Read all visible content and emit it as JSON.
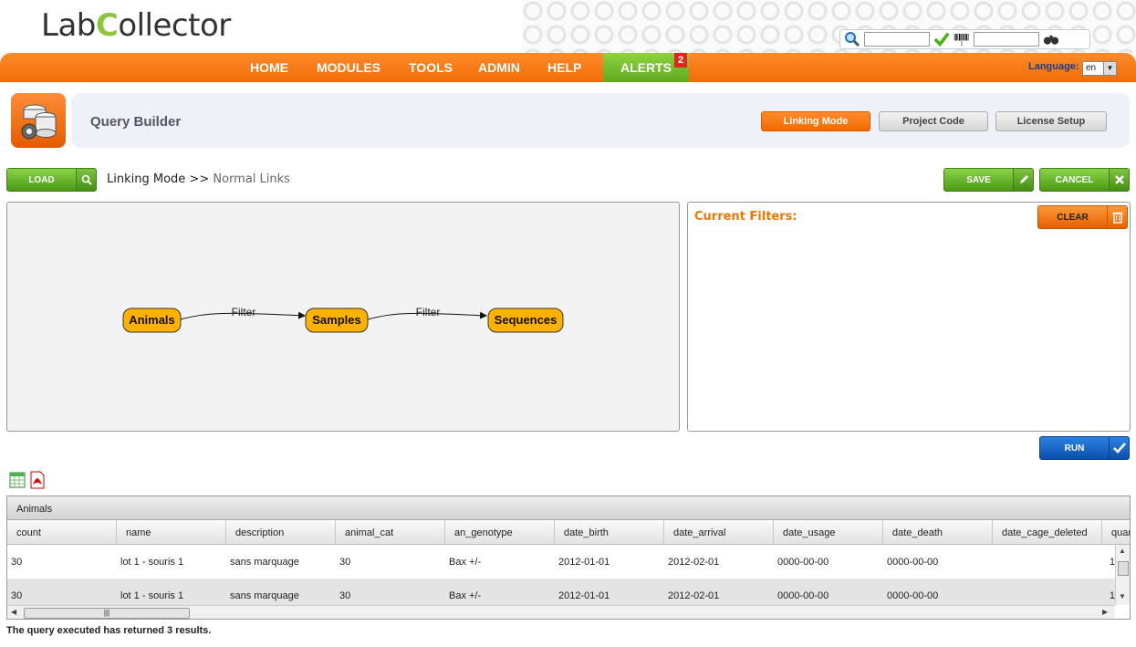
{
  "header": {
    "logo_prefix": "Lab",
    "logo_c": "C",
    "logo_suffix": "ollector",
    "barcode_digit": "1"
  },
  "nav": {
    "items": [
      "HOME",
      "MODULES",
      "TOOLS",
      "ADMIN",
      "HELP"
    ],
    "alerts_label": "ALERTS",
    "alerts_count": "2",
    "language_label": "Language:",
    "language_value": "en"
  },
  "module": {
    "title": "Query Builder",
    "tabs": [
      "Linking Mode",
      "Project Code",
      "License Setup"
    ],
    "active_tab": "Linking Mode"
  },
  "toolbar": {
    "load_label": "LOAD",
    "save_label": "SAVE",
    "cancel_label": "CANCEL",
    "clear_label": "CLEAR",
    "run_label": "RUN"
  },
  "breadcrumb": {
    "mode": "Linking Mode",
    "separator": ">>",
    "sub": "Normal Links"
  },
  "graph": {
    "nodes": [
      "Animals",
      "Samples",
      "Sequences"
    ],
    "edge_label": "Filter"
  },
  "filters": {
    "heading": "Current Filters:"
  },
  "table": {
    "caption": "Animals",
    "columns": [
      "count",
      "name",
      "description",
      "animal_cat",
      "an_genotype",
      "date_birth",
      "date_arrival",
      "date_usage",
      "date_death",
      "date_cage_deleted",
      "quar"
    ],
    "rows": [
      [
        "30",
        "lot 1 - souris 1",
        "sans marquage",
        "30",
        "Bax +/-",
        "2012-01-01",
        "2012-02-01",
        "0000-00-00",
        "0000-00-00",
        "",
        "1"
      ],
      [
        "30",
        "lot 1 - souris 1",
        "sans marquage",
        "30",
        "Bax +/-",
        "2012-01-01",
        "2012-02-01",
        "0000-00-00",
        "0000-00-00",
        "",
        "1"
      ]
    ]
  },
  "status": "The query executed has returned 3 results.",
  "colors": {
    "orange": "#f47b20",
    "green": "#6cbf2a",
    "blue": "#0b5ed7",
    "filter_heading": "#ee7700"
  }
}
